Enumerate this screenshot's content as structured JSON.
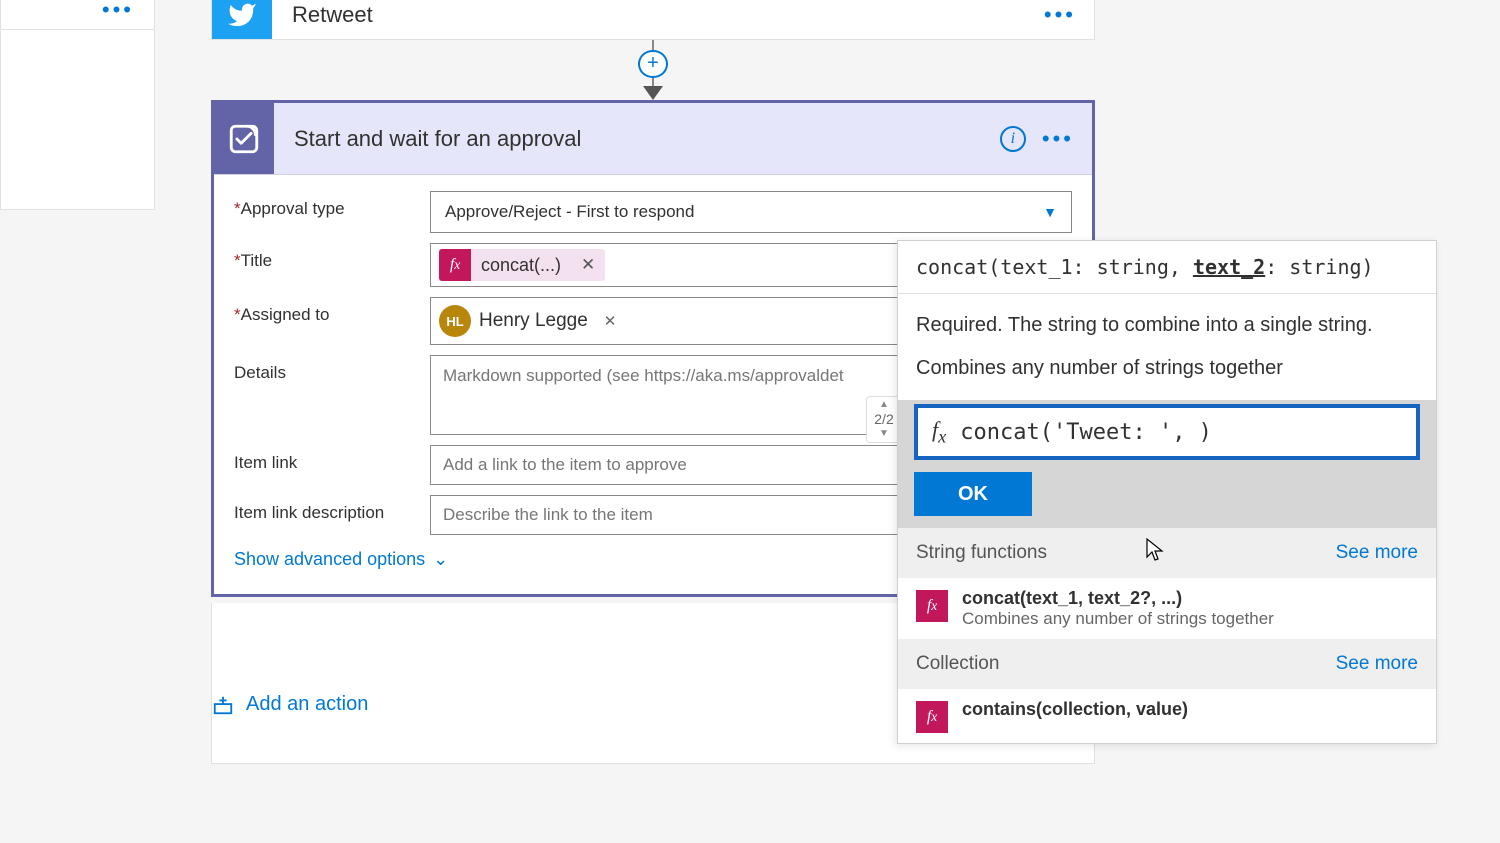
{
  "sidecard": {},
  "retweet": {
    "title": "Retweet"
  },
  "approval": {
    "title": "Start and wait for an approval",
    "fields": {
      "approval_type_label": "Approval type",
      "approval_type_value": "Approve/Reject - First to respond",
      "title_label": "Title",
      "title_chip": "concat(...)",
      "assigned_label": "Assigned to",
      "assigned_initials": "HL",
      "assigned_name": "Henry Legge",
      "details_label": "Details",
      "details_placeholder": "Markdown supported (see https://aka.ms/approvaldet",
      "item_link_label": "Item link",
      "item_link_placeholder": "Add a link to the item to approve",
      "item_link_desc_label": "Item link description",
      "item_link_desc_placeholder": "Describe the link to the item"
    },
    "advanced": "Show advanced options"
  },
  "paging": "2/2",
  "add_action": "Add an action",
  "expr": {
    "sig_pre": "concat(text_1: string, ",
    "sig_under": "text_2",
    "sig_post": ": string)",
    "desc1": "Required. The string to combine into a single string.",
    "desc2": "Combines any number of strings together",
    "input": "concat('Tweet: ', )",
    "ok": "OK",
    "cat1": "String functions",
    "see": "See more",
    "fn1_name": "concat(text_1, text_2?, ...)",
    "fn1_sub": "Combines any number of strings together",
    "cat2": "Collection",
    "fn2_name": "contains(collection, value)"
  }
}
